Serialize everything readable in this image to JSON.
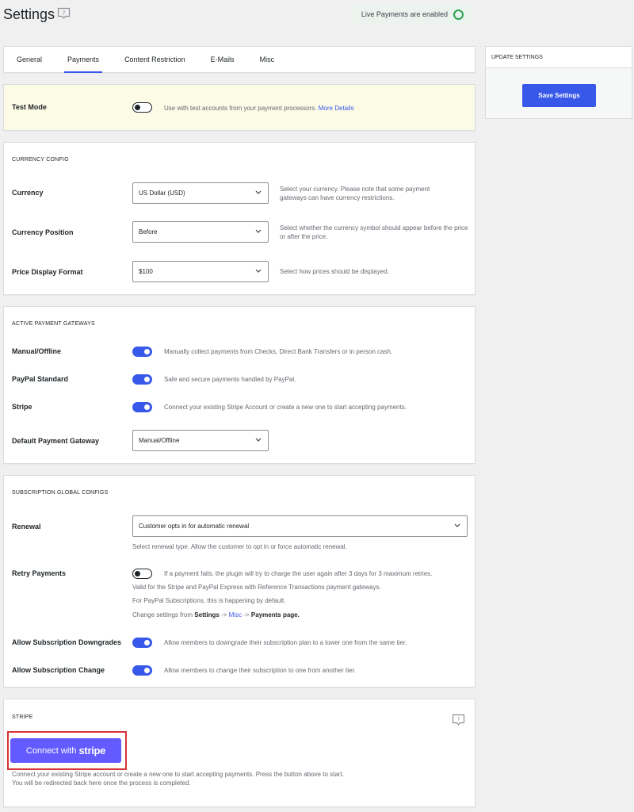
{
  "header": {
    "title": "Settings",
    "help_icon": "question-bubble-icon",
    "live_status": "Live Payments are enabled",
    "live_status_color": "#2ea44f"
  },
  "tabs": [
    {
      "label": "General",
      "active": false
    },
    {
      "label": "Payments",
      "active": true
    },
    {
      "label": "Content Restriction",
      "active": false
    },
    {
      "label": "E-Mails",
      "active": false
    },
    {
      "label": "Misc",
      "active": false
    }
  ],
  "test_mode": {
    "label": "Test Mode",
    "enabled": false,
    "description": "Use with test accounts from your payment processors.",
    "link": "More Details"
  },
  "currency_config": {
    "title": "CURRENCY CONFIG",
    "currency": {
      "label": "Currency",
      "value": "US Dollar (USD)",
      "description": "Select your currency. Please note that some payment gateways can have currency restrictions."
    },
    "position": {
      "label": "Currency Position",
      "value": "Before",
      "description": "Select whether the currency symbol should appear before the price or after the price."
    },
    "format": {
      "label": "Price Display Format",
      "value": "$100",
      "description": "Select how prices should be displayed."
    }
  },
  "gateways": {
    "title": "ACTIVE PAYMENT GATEWAYS",
    "items": [
      {
        "label": "Manual/Offline",
        "enabled": true,
        "description": "Manually collect payments from Checks, Direct Bank Transfers or in person cash."
      },
      {
        "label": "PayPal Standard",
        "enabled": true,
        "description": "Safe and secure payments handled by PayPal."
      },
      {
        "label": "Stripe",
        "enabled": true,
        "description": "Connect your existing Stripe Account or create a new one to start accepting payments."
      }
    ],
    "default": {
      "label": "Default Payment Gateway",
      "value": "Manual/Offline"
    }
  },
  "subscriptions": {
    "title": "SUBSCRIPTION GLOBAL CONFIGS",
    "renewal": {
      "label": "Renewal",
      "value": "Customer opts in for automatic renewal",
      "description": "Select renewal type. Allow the customer to opt in or force automatic renewal."
    },
    "retry": {
      "label": "Retry Payments",
      "enabled": false,
      "description": "If a payment fails, the plugin will try to charge the user again after 3 days for 3 maximum retries.",
      "note1": "Valid for the Stripe and PayPal Express with Reference Transactions payment gateways.",
      "note2": "For PayPal Subscriptions, this is happening by default.",
      "note3_prefix": "Change settings from",
      "note3_settings": "Settings",
      "note3_arrow1": "->",
      "note3_misc": "Misc",
      "note3_arrow2": "->",
      "note3_payments": "Payments page."
    },
    "downgrades": {
      "label": "Allow Subscription Downgrades",
      "enabled": true,
      "description": "Allow members to downgrade their subscription plan to a lower one from the same tier."
    },
    "change": {
      "label": "Allow Subscription Change",
      "enabled": true,
      "description": "Allow members to change their subscription to one from another tier."
    }
  },
  "stripe": {
    "title": "STRIPE",
    "button_prefix": "Connect with",
    "button_brand": "stripe",
    "button_color": "#635bff",
    "description1": "Connect your existing Stripe account or create a new one to start accepting payments. Press the button above to start.",
    "description2": "You will be redirected back here once the process is completed."
  },
  "sidebar": {
    "title": "UPDATE SETTINGS",
    "save_label": "Save Settings",
    "accent": "#3858e9"
  }
}
